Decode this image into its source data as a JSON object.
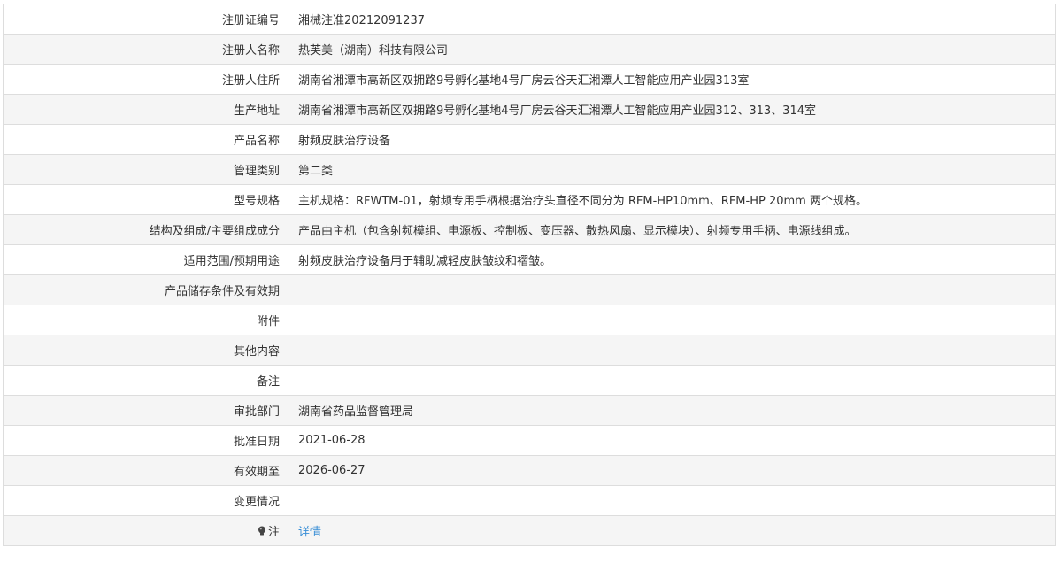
{
  "rows": [
    {
      "label": "注册证编号",
      "value": "湘械注准20212091237"
    },
    {
      "label": "注册人名称",
      "value": "热芙美（湖南）科技有限公司"
    },
    {
      "label": "注册人住所",
      "value": "湖南省湘潭市高新区双拥路9号孵化基地4号厂房云谷天汇湘潭人工智能应用产业园313室"
    },
    {
      "label": "生产地址",
      "value": "湖南省湘潭市高新区双拥路9号孵化基地4号厂房云谷天汇湘潭人工智能应用产业园312、313、314室"
    },
    {
      "label": "产品名称",
      "value": "射频皮肤治疗设备"
    },
    {
      "label": "管理类别",
      "value": "第二类"
    },
    {
      "label": "型号规格",
      "value": "主机规格：RFWTM-01，射频专用手柄根据治疗头直径不同分为 RFM-HP10mm、RFM-HP 20mm 两个规格。"
    },
    {
      "label": "结构及组成/主要组成成分",
      "value": "产品由主机（包含射频模组、电源板、控制板、变压器、散热风扇、显示模块）、射频专用手柄、电源线组成。"
    },
    {
      "label": "适用范围/预期用途",
      "value": "射频皮肤治疗设备用于辅助减轻皮肤皱纹和褶皱。"
    },
    {
      "label": "产品储存条件及有效期",
      "value": ""
    },
    {
      "label": "附件",
      "value": ""
    },
    {
      "label": "其他内容",
      "value": ""
    },
    {
      "label": "备注",
      "value": ""
    },
    {
      "label": "审批部门",
      "value": "湖南省药品监督管理局"
    },
    {
      "label": "批准日期",
      "value": "2021-06-28"
    },
    {
      "label": "有效期至",
      "value": "2026-06-27"
    },
    {
      "label": "变更情况",
      "value": ""
    }
  ],
  "note": {
    "label": "注",
    "icon": "lightbulb-icon",
    "link_text": "详情"
  },
  "colors": {
    "border": "#dddddd",
    "stripe": "#f5f5f5",
    "link": "#3a8fd6"
  }
}
